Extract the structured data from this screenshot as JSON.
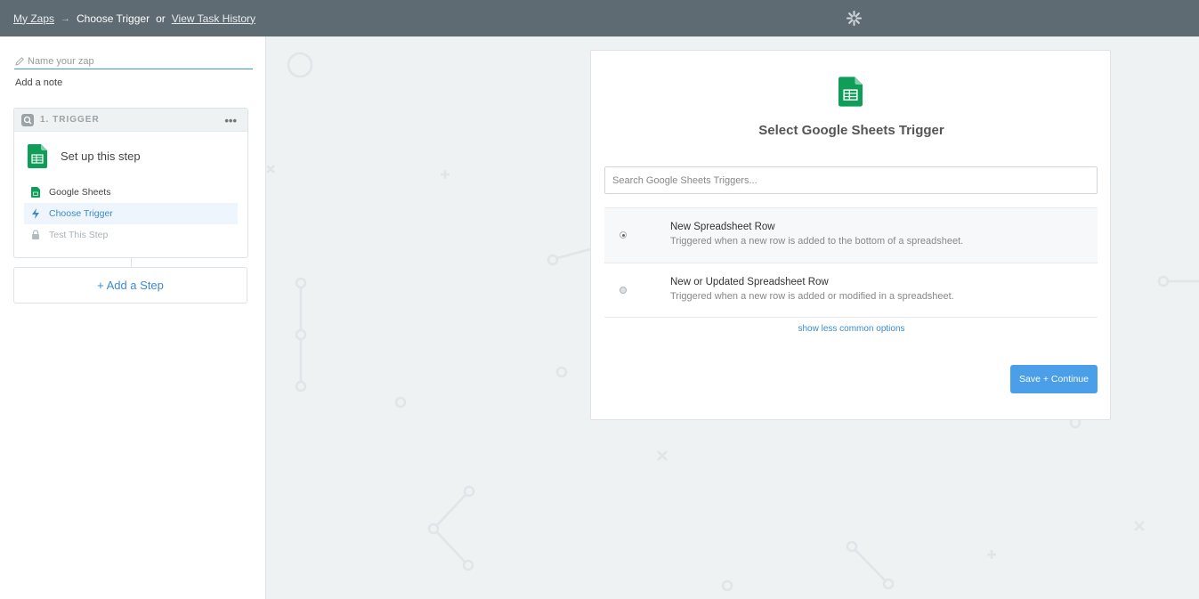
{
  "topbar": {
    "my_zaps": "My Zaps",
    "arrow": "→",
    "current": "Choose Trigger",
    "or": "or",
    "task_history": "View Task History"
  },
  "sidebar": {
    "zap_name_placeholder": "Name your zap",
    "add_note": "Add a note",
    "step": {
      "header": "1. TRIGGER",
      "menu": "•••",
      "title": "Set up this step",
      "substeps": [
        {
          "label": "Google Sheets"
        },
        {
          "label": "Choose Trigger"
        },
        {
          "label": "Test This Step"
        }
      ]
    },
    "add_step": "+ Add a Step"
  },
  "card": {
    "title": "Select Google Sheets Trigger",
    "search_placeholder": "Search Google Sheets Triggers...",
    "options": [
      {
        "title": "New Spreadsheet Row",
        "description": "Triggered when a new row is added to the bottom of a spreadsheet.",
        "selected": true
      },
      {
        "title": "New or Updated Spreadsheet Row",
        "description": "Triggered when a new row is added or modified in a spreadsheet.",
        "selected": false
      }
    ],
    "less_options": "show less common options",
    "save_button": "Save + Continue"
  },
  "colors": {
    "topbar": "#5f6b72",
    "accent": "#3a8cd0",
    "button": "#4a9fe8",
    "sheets_green": "#0f9d58"
  }
}
